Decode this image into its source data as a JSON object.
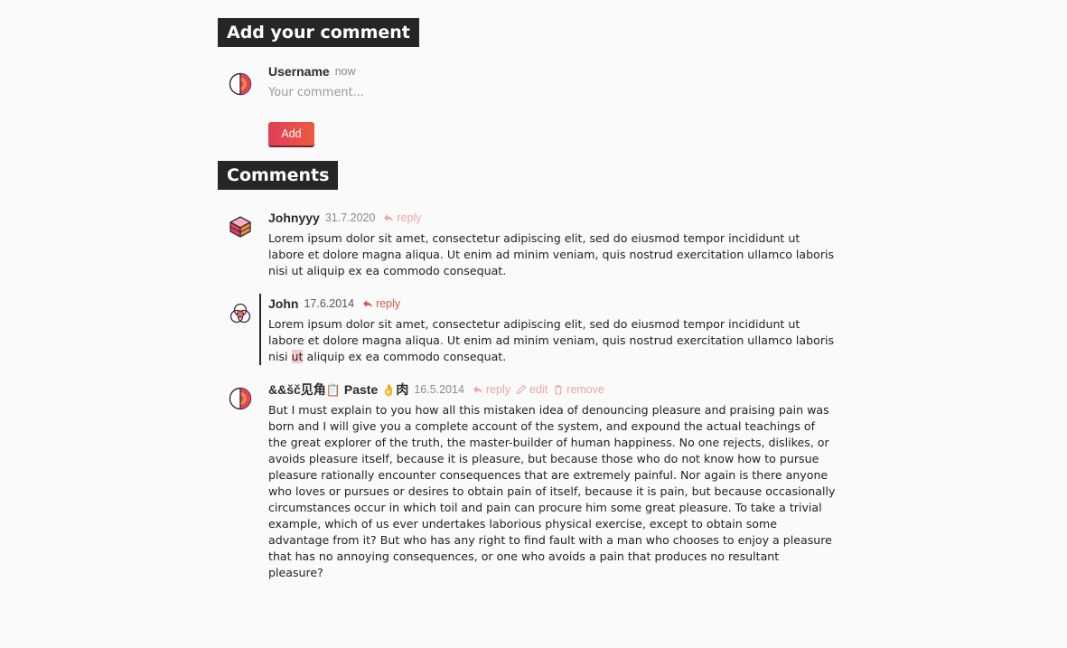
{
  "add_section": {
    "heading": "Add your comment",
    "username": "Username",
    "time": "now",
    "input_value": "",
    "input_placeholder": "Your comment...",
    "add_label": "Add"
  },
  "comments_section": {
    "heading": "Comments"
  },
  "comments": [
    {
      "author": "Johnyyy",
      "date": "31.7.2020",
      "reply_label": "reply",
      "text": "Lorem ipsum dolor sit amet, consectetur adipiscing elit, sed do eiusmod tempor incididunt ut labore et dolore magna aliqua. Ut enim ad minim veniam, quis nostrud exercitation ullamco laboris nisi ut aliquip ex ea commodo consequat."
    },
    {
      "author": "John",
      "date": "17.6.2014",
      "reply_label": "reply",
      "text_before": "Lorem ipsum dolor sit amet, consectetur adipiscing elit, sed do eiusmod tempor incididunt ut labore et dolore magna aliqua. Ut enim ad minim veniam, quis nostrud exercitation ullamco laboris nisi ",
      "text_highlight": "ut",
      "text_after": " aliquip ex ea commodo consequat."
    },
    {
      "author_prefix": "&&šč",
      "author_cjk": "见角",
      "author_clipboard": "📋",
      "author_name": " Paste ",
      "author_hand": "👌",
      "author_suffix": "肉",
      "date": "16.5.2014",
      "reply_label": "reply",
      "edit_label": "edit",
      "remove_label": "remove",
      "text": "But I must explain to you how all this mistaken idea of denouncing pleasure and praising pain was born and I will give you a complete account of the system, and expound the actual teachings of the great explorer of the truth, the master-builder of human happiness. No one rejects, dislikes, or avoids pleasure itself, because it is pleasure, but because those who do not know how to pursue pleasure rationally encounter consequences that are extremely painful. Nor again is there anyone who loves or pursues or desires to obtain pain of itself, because it is pain, but because occasionally circumstances occur in which toil and pain can procure him some great pleasure. To take a trivial example, which of us ever undertakes laborious physical exercise, except to obtain some advantage from it? But who has any right to find fault with a man who chooses to enjoy a pleasure that has no annoying consequences, or one who avoids a pain that produces no resultant pleasure?"
    }
  ],
  "colors": {
    "heading_bg": "#262626",
    "accent": "#d9534f",
    "accent_light": "#e8a6a6",
    "button_gradient_start": "#e03e5a",
    "button_gradient_end": "#ee5a3e",
    "highlight": "#f6c7c7"
  },
  "icons": {
    "avatar_current_user": "half-circle-avatar-icon",
    "avatar_johnyyy": "cube-avatar-icon",
    "avatar_john": "venn-avatar-icon",
    "reply": "reply-arrow-icon",
    "edit": "pencil-icon",
    "remove": "trash-icon"
  }
}
